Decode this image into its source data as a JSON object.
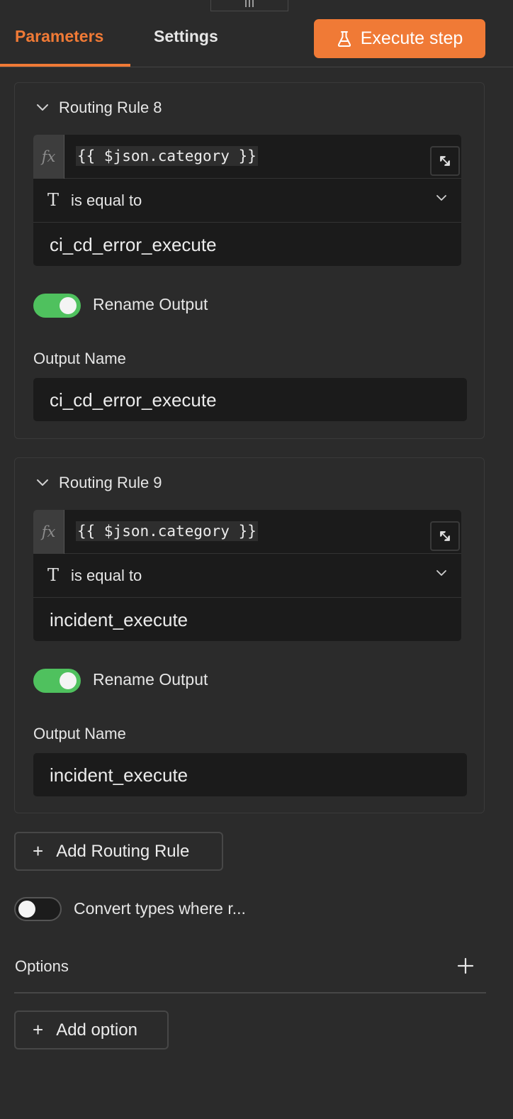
{
  "header": {
    "tabs": [
      {
        "label": "Parameters",
        "active": true
      },
      {
        "label": "Settings",
        "active": false
      }
    ],
    "execute_button": {
      "label": "Execute step",
      "icon": "flask-icon"
    }
  },
  "rules": [
    {
      "title": "Routing Rule 8",
      "expression": "{{ $json.category }}",
      "fx_label": "fx",
      "type_icon": "T",
      "operator": "is equal to",
      "value": "ci_cd_error_execute",
      "rename_output_label": "Rename Output",
      "rename_output_on": true,
      "output_name_label": "Output Name",
      "output_name": "ci_cd_error_execute"
    },
    {
      "title": "Routing Rule 9",
      "expression": "{{ $json.category }}",
      "fx_label": "fx",
      "type_icon": "T",
      "operator": "is equal to",
      "value": "incident_execute",
      "rename_output_label": "Rename Output",
      "rename_output_on": true,
      "output_name_label": "Output Name",
      "output_name": "incident_execute"
    }
  ],
  "add_routing_rule": {
    "label": "Add Routing Rule",
    "icon": "+"
  },
  "convert_types": {
    "label": "Convert types where r...",
    "on": false
  },
  "options": {
    "label": "Options",
    "add_icon": "+"
  },
  "add_option": {
    "label": "Add option",
    "icon": "+"
  },
  "colors": {
    "accent": "#f07a36",
    "toggle_on": "#4fc15e",
    "background": "#2b2b2b",
    "input_background": "#1b1b1b"
  }
}
